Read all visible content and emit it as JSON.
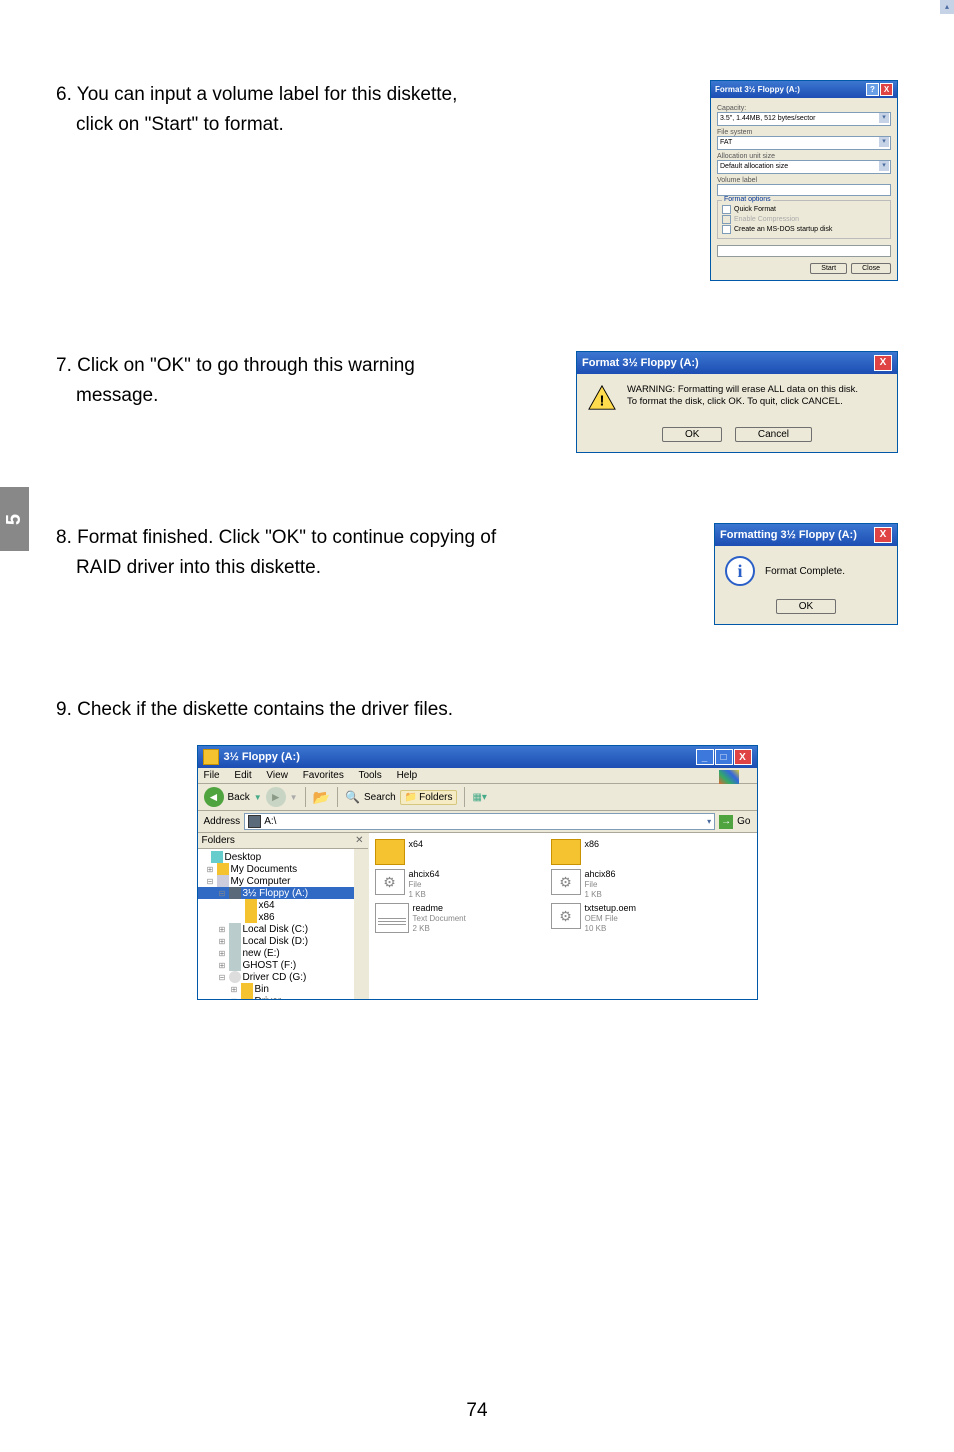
{
  "page_number": "74",
  "side_tab": "5",
  "steps": {
    "s6": {
      "line1": "6. You can input a volume label for this diskette,",
      "line2": "click on \"Start\" to format."
    },
    "s7": {
      "line1": "7. Click on \"OK\" to go through this warning",
      "line2": "message."
    },
    "s8": {
      "line1": "8. Format finished. Click \"OK\" to continue copying of",
      "line2": "RAID driver into this diskette."
    },
    "s9": {
      "line1": "9. Check if the diskette contains the driver files."
    }
  },
  "format_dialog": {
    "title": "Format 3½ Floppy (A:)",
    "capacity_label": "Capacity:",
    "capacity_value": "3.5\", 1.44MB, 512 bytes/sector",
    "fs_label": "File system",
    "fs_value": "FAT",
    "alloc_label": "Allocation unit size",
    "alloc_value": "Default allocation size",
    "vol_label": "Volume label",
    "options_title": "Format options",
    "opt_quick": "Quick Format",
    "opt_compress": "Enable Compression",
    "opt_msdos": "Create an MS-DOS startup disk",
    "btn_start": "Start",
    "btn_close": "Close"
  },
  "warning_dialog": {
    "title": "Format 3½ Floppy (A:)",
    "line1": "WARNING: Formatting will erase ALL data on this disk.",
    "line2": "To format the disk, click OK. To quit, click CANCEL.",
    "btn_ok": "OK",
    "btn_cancel": "Cancel"
  },
  "complete_dialog": {
    "title": "Formatting 3½ Floppy (A:)",
    "message": "Format Complete.",
    "btn_ok": "OK"
  },
  "explorer": {
    "title": "3½ Floppy (A:)",
    "menu": {
      "file": "File",
      "edit": "Edit",
      "view": "View",
      "favorites": "Favorites",
      "tools": "Tools",
      "help": "Help"
    },
    "toolbar": {
      "back": "Back",
      "search": "Search",
      "folders": "Folders"
    },
    "address_label": "Address",
    "address_value": "A:\\",
    "go": "Go",
    "sidebar_title": "Folders",
    "tree": {
      "desktop": "Desktop",
      "mydocs": "My Documents",
      "mycomp": "My Computer",
      "floppy": "3½ Floppy (A:)",
      "x64": "x64",
      "x86": "x86",
      "localc": "Local Disk (C:)",
      "locald": "Local Disk (D:)",
      "newe": "new (E:)",
      "ghost": "GHOST (F:)",
      "cd": "Driver CD (G:)",
      "bin": "Bin",
      "driver": "Driver"
    },
    "files": {
      "x64": {
        "name": "x64"
      },
      "x86": {
        "name": "x86"
      },
      "ahcix64": {
        "name": "ahcix64",
        "type": "File",
        "size": "1 KB"
      },
      "ahcix86": {
        "name": "ahcix86",
        "type": "File",
        "size": "1 KB"
      },
      "readme": {
        "name": "readme",
        "type": "Text Document",
        "size": "2 KB"
      },
      "txtsetup": {
        "name": "txtsetup.oem",
        "type": "OEM File",
        "size": "10 KB"
      }
    }
  }
}
